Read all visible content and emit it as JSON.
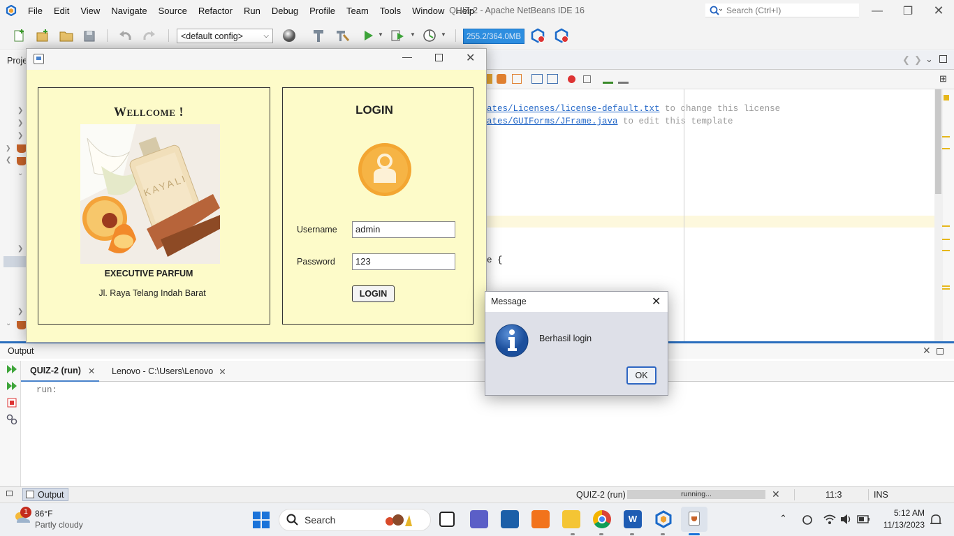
{
  "netbeans": {
    "window_title": "QUIZ-2 - Apache NetBeans IDE 16",
    "menu": [
      "File",
      "Edit",
      "View",
      "Navigate",
      "Source",
      "Refactor",
      "Run",
      "Debug",
      "Profile",
      "Team",
      "Tools",
      "Window",
      "Help"
    ],
    "search_placeholder": "Search (Ctrl+I)",
    "config_select": "<default config>",
    "memory": "255.2/364.0MB",
    "projects_tab": "Proje",
    "code_lines": [
      {
        "link": "ates/Licenses/license-default.txt",
        "rest": " to change this license"
      },
      {
        "link": "ates/GUIForms/JFrame.java",
        "rest": " to edit this template"
      }
    ],
    "code_fragment": "e {"
  },
  "output": {
    "title": "Output",
    "tabs": [
      {
        "label": "QUIZ-2 (run)"
      },
      {
        "label": "Lenovo - C:\\Users\\Lenovo"
      }
    ],
    "console": "run:"
  },
  "status": {
    "output_tab": "Output",
    "project": "QUIZ-2 (run)",
    "progress_text": "running...",
    "progress_fraction": 1.0,
    "position": "11:3",
    "mode": "INS"
  },
  "login_window": {
    "welcome": "Wellcome !",
    "brand": "EXECUTIVE PARFUM",
    "address": "Jl. Raya Telang Indah Barat",
    "perfume_label": "KAYALI",
    "login_title": "LOGIN",
    "username_label": "Username",
    "username_value": "admin",
    "password_label": "Password",
    "password_value": "123",
    "login_button": "LOGIN"
  },
  "dialog": {
    "title": "Message",
    "message": "Berhasil login",
    "ok_button": "OK"
  },
  "taskbar": {
    "weather_temp": "86°F",
    "weather_desc": "Partly cloudy",
    "weather_badge": "1",
    "search_label": "Search",
    "time": "5:12 AM",
    "date": "11/13/2023"
  },
  "colors": {
    "login_bg": "#fdfbc9",
    "avatar": "#f3a632",
    "accent": "#2a6ebd"
  }
}
